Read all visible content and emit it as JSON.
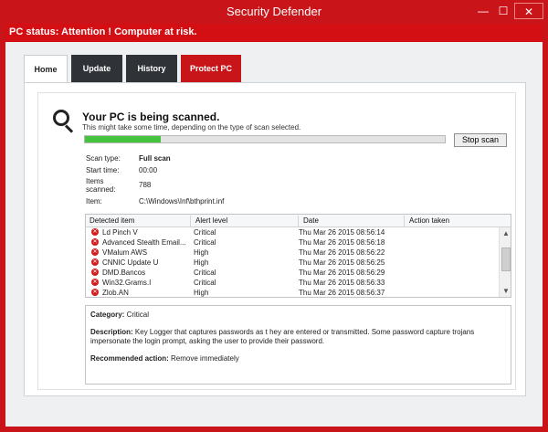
{
  "window": {
    "title": "Security Defender",
    "status": "PC status: Attention ! Computer at risk.",
    "minimize_glyph": "—",
    "maximize_glyph": "☐",
    "close_glyph": "✕"
  },
  "tabs": [
    {
      "label": "Home",
      "active": true
    },
    {
      "label": "Update"
    },
    {
      "label": "History"
    },
    {
      "label": "Protect PC",
      "accent": "#c8151a"
    }
  ],
  "scan": {
    "heading": "Your PC is being scanned.",
    "subtitle": "This might take some time, depending on the type of scan selected.",
    "progress": 0.21,
    "stop_label": "Stop scan",
    "scan_type_label": "Scan type:",
    "scan_type_value": "Full scan",
    "start_time_label": "Start time:",
    "start_time_value": "00:00",
    "items_label_1": "Items",
    "items_label_2": "scanned:",
    "items_value": "788",
    "item_label": "Item:",
    "item_value": "C:\\Windows\\Inf\\bthprint.inf"
  },
  "table": {
    "columns": [
      "Detected item",
      "Alert level",
      "Date",
      "Action taken"
    ],
    "rows": [
      {
        "item": "Ld Pinch V",
        "level": "Critical",
        "date": "Thu Mar 26 2015 08:56:14"
      },
      {
        "item": "Advanced Stealth Email...",
        "level": "Critical",
        "date": "Thu Mar 26 2015 08:56:18"
      },
      {
        "item": "VMalum AWS",
        "level": "High",
        "date": "Thu Mar 26 2015 08:56:22"
      },
      {
        "item": "CNNIC Update U",
        "level": "High",
        "date": "Thu Mar 26 2015 08:56:25"
      },
      {
        "item": "DMD.Bancos",
        "level": "Critical",
        "date": "Thu Mar 26 2015 08:56:29"
      },
      {
        "item": "Win32.Grams.I",
        "level": "Critical",
        "date": "Thu Mar 26 2015 08:56:33"
      },
      {
        "item": "Zlob.AN",
        "level": "High",
        "date": "Thu Mar 26 2015 08:56:37"
      }
    ]
  },
  "detail": {
    "category_label": "Category:",
    "category_value": "Critical",
    "description_label": "Description:",
    "description_value": "Key Logger that captures passwords as t hey are entered or transmitted. Some password capture trojans impersonate the login prompt, asking the user to provide their password.",
    "action_label": "Recommended action:",
    "action_value": "Remove immediately"
  }
}
